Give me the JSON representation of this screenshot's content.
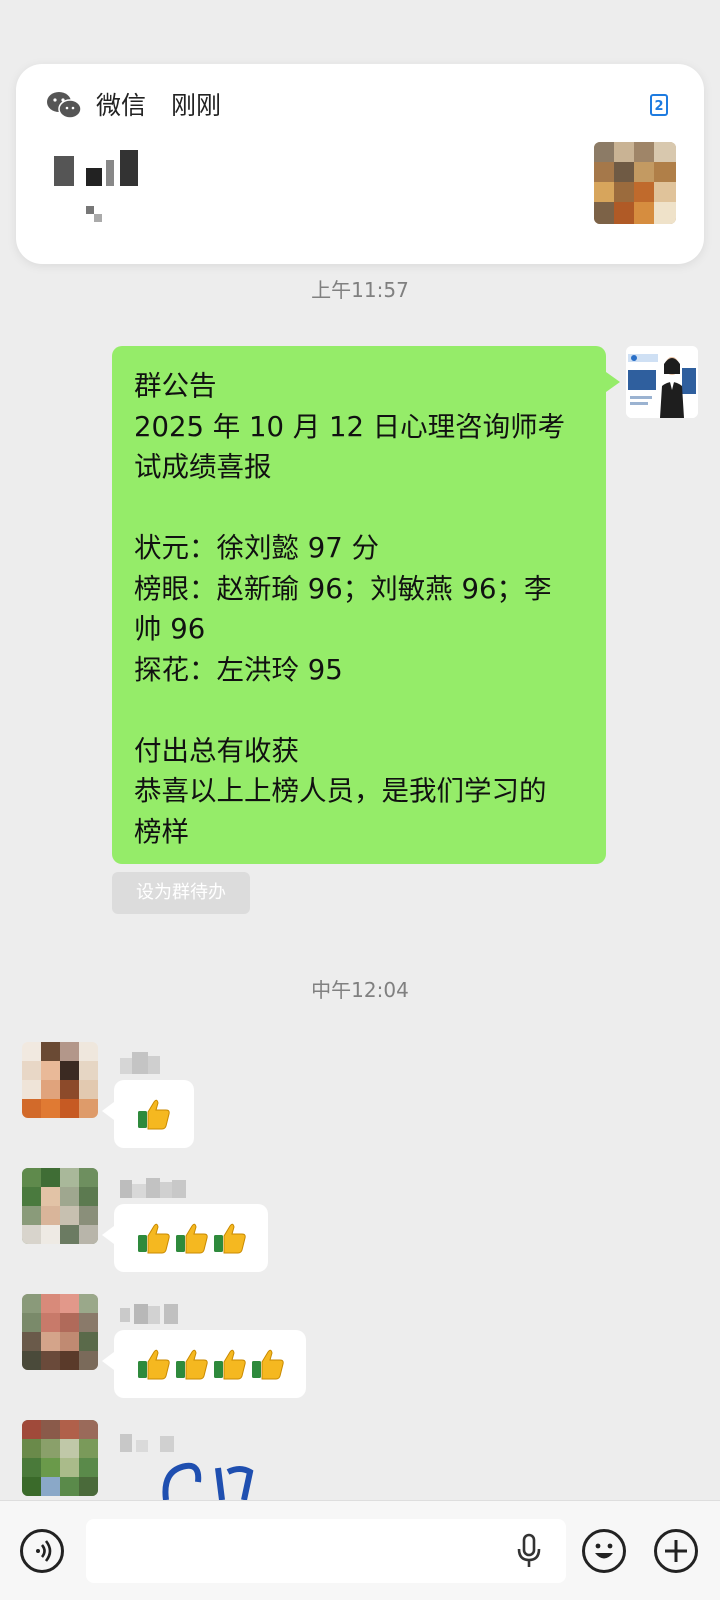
{
  "notification": {
    "app_name": "微信",
    "time": "刚刚",
    "badge_icon": "dual-sim-2-icon",
    "app_icon": "wechat-icon"
  },
  "timestamps": {
    "first": "上午11:57",
    "second": "中午12:04"
  },
  "announcement": {
    "lines": [
      "群公告",
      "2025 年 10 月 12 日心理咨询师考",
      "试成绩喜报",
      "",
      "状元：徐刘懿 97 分",
      "榜眼：赵新瑜 96；刘敏燕 96；李",
      "帅 96",
      "探花：左洪玲 95",
      "",
      "付出总有收获",
      "恭喜以上上榜人员，是我们学习的",
      "榜样"
    ],
    "todo_button": "设为群待办"
  },
  "replies": [
    {
      "thumbs_count": 1
    },
    {
      "thumbs_count": 3
    },
    {
      "thumbs_count": 4
    }
  ],
  "input_bar": {
    "voice_icon": "voice-toggle-icon",
    "mic_icon": "microphone-icon",
    "emoji_icon": "emoji-icon",
    "plus_icon": "plus-icon"
  },
  "colors": {
    "own_bubble": "#95ec69",
    "background": "#ededed",
    "other_bubble": "#ffffff"
  }
}
